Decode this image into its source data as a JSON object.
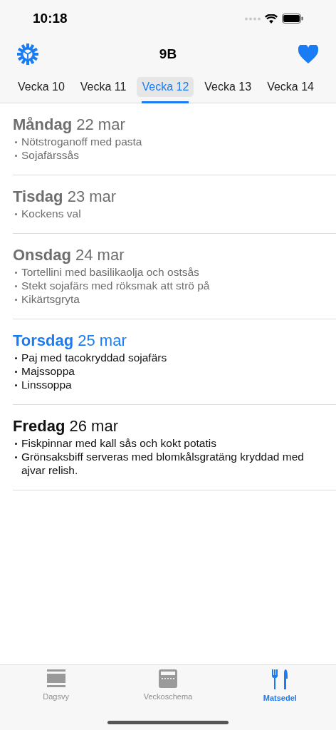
{
  "status_bar": {
    "time": "10:18"
  },
  "header": {
    "title": "9B"
  },
  "weeks": [
    {
      "label": "Vecka 10",
      "selected": false
    },
    {
      "label": "Vecka 11",
      "selected": false
    },
    {
      "label": "Vecka 12",
      "selected": true
    },
    {
      "label": "Vecka 13",
      "selected": false
    },
    {
      "label": "Vecka 14",
      "selected": false
    }
  ],
  "days": [
    {
      "day": "Måndag",
      "date": "22 mar",
      "kind": "past",
      "items": [
        "Nötstroganoff med pasta",
        "Sojafärssås"
      ]
    },
    {
      "day": "Tisdag",
      "date": "23 mar",
      "kind": "past",
      "items": [
        "Kockens val"
      ]
    },
    {
      "day": "Onsdag",
      "date": "24 mar",
      "kind": "past",
      "items": [
        "Tortellini med basilikaolja och ostsås",
        "Stekt sojafärs med röksmak att strö på",
        "Kikärtsgryta"
      ]
    },
    {
      "day": "Torsdag",
      "date": "25 mar",
      "kind": "today",
      "items": [
        "Paj med tacokryddad sojafärs",
        "Majssoppa",
        "Linssoppa"
      ]
    },
    {
      "day": "Fredag",
      "date": "26 mar",
      "kind": "upcoming",
      "items": [
        "Fiskpinnar med kall sås och kokt potatis",
        "Grönsaksbiff serveras med blomkålsgratäng kryddad med ajvar relish."
      ]
    }
  ],
  "tab_bar": [
    {
      "label": "Dagsvy",
      "kind": "day",
      "selected": false
    },
    {
      "label": "Veckoschema",
      "kind": "week",
      "selected": false
    },
    {
      "label": "Matsedel",
      "kind": "menu",
      "selected": true
    }
  ]
}
